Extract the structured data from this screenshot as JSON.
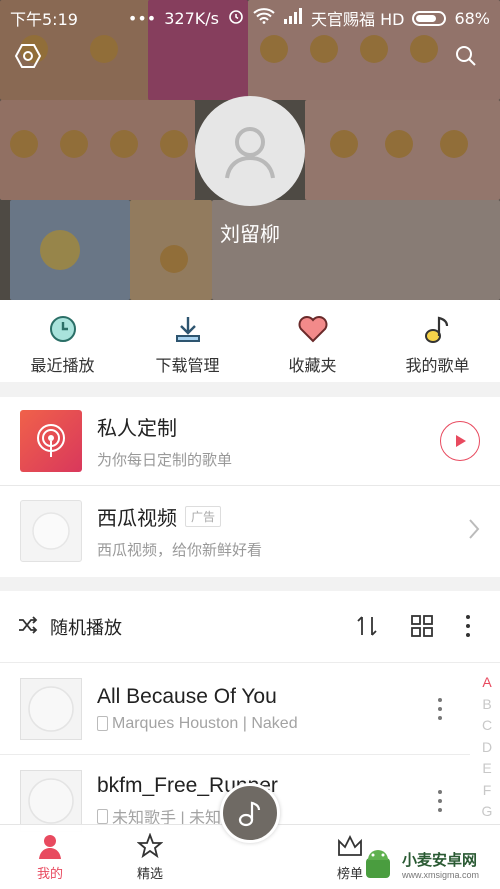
{
  "status_bar": {
    "time": "下午5:19",
    "dots": "•••",
    "speed": "327K/s",
    "carrier": "天官赐福 HD",
    "battery": "68%"
  },
  "header": {
    "username": "刘留柳",
    "left_icon": "hexagon-settings-icon",
    "right_icon": "search-icon"
  },
  "quick_actions": [
    {
      "label": "最近播放",
      "icon": "clock-icon",
      "color": "#2bb3a3"
    },
    {
      "label": "下载管理",
      "icon": "download-icon",
      "color": "#3a8fd6"
    },
    {
      "label": "收藏夹",
      "icon": "heart-icon",
      "color": "#e8505b"
    },
    {
      "label": "我的歌单",
      "icon": "music-note-icon",
      "color": "#f3c623"
    }
  ],
  "cards": [
    {
      "title": "私人定制",
      "subtitle": "为你每日定制的歌单",
      "action": "play"
    },
    {
      "title": "西瓜视频",
      "tag": "广告",
      "subtitle": "西瓜视频，给你新鲜好看",
      "action": "chevron"
    }
  ],
  "songs_header": {
    "label": "随机播放"
  },
  "songs": [
    {
      "title": "All Because Of You",
      "subtitle": "Marques Houston | Naked"
    },
    {
      "title": "bkfm_Free_Runner",
      "subtitle": "未知歌手 | 未知专辑"
    }
  ],
  "alpha_index": [
    "A",
    "B",
    "C",
    "D",
    "E",
    "F",
    "G"
  ],
  "bottom_nav": [
    {
      "label": "我的",
      "icon": "person-icon",
      "active": true
    },
    {
      "label": "精选",
      "icon": "star-icon",
      "active": false
    },
    {
      "label": "榜单",
      "icon": "crown-icon",
      "active": false
    }
  ],
  "watermark": {
    "title": "小麦安卓网",
    "url": "www.xmsigma.com"
  },
  "colors": {
    "accent": "#e84a5f",
    "text": "#222222",
    "subtext": "#999999"
  }
}
